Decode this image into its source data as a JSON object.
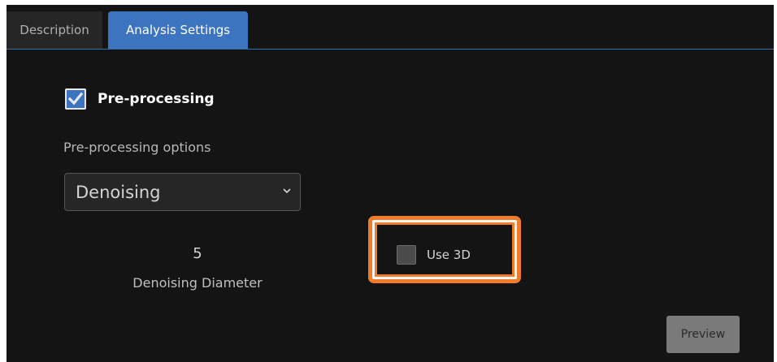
{
  "tabs": [
    {
      "label": "Description",
      "active": false
    },
    {
      "label": "Analysis Settings",
      "active": true
    }
  ],
  "preprocessing": {
    "checkbox_label": "Pre-processing",
    "checked": true,
    "options_label": "Pre-processing options",
    "selected_option": "Denoising"
  },
  "denoising": {
    "diameter_value": "5",
    "diameter_label": "Denoising Diameter"
  },
  "use3d": {
    "label": "Use 3D",
    "checked": false
  },
  "preview_label": "Preview",
  "colors": {
    "accent": "#3c74c0",
    "highlight": "#ee7c2b",
    "background": "#141414"
  }
}
